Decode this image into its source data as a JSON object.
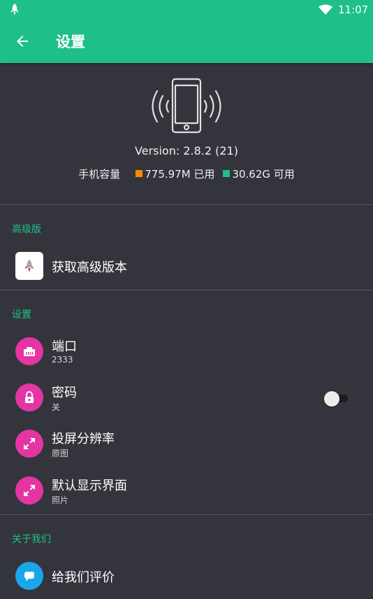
{
  "status_bar": {
    "time": "11:07"
  },
  "app_bar": {
    "title": "设置"
  },
  "device_info": {
    "version": "Version: 2.8.2 (21)",
    "storage_label": "手机容量",
    "used": "775.97M 已用",
    "free": "30.62G 可用",
    "used_color": "#ff8a00",
    "free_color": "#1fbf8a"
  },
  "sections": {
    "premium": {
      "header": "高级版",
      "items": [
        {
          "title": "获取高级版本"
        }
      ]
    },
    "settings": {
      "header": "设置",
      "items": [
        {
          "title": "端口",
          "subtitle": "2333"
        },
        {
          "title": "密码",
          "subtitle": "关",
          "toggle_on": false
        },
        {
          "title": "投屏分辨率",
          "subtitle": "原图"
        },
        {
          "title": "默认显示界面",
          "subtitle": "照片"
        }
      ]
    },
    "about": {
      "header": "关于我们",
      "items": [
        {
          "title": "给我们评价"
        }
      ]
    }
  },
  "colors": {
    "accent": "#1fbf8a",
    "icon_pink": "#e535a4",
    "icon_blue": "#1aa6e8",
    "background": "#34353c"
  },
  "icons": {
    "status_app": "rocket-icon",
    "status_wifi": "wifi-icon",
    "back": "arrow-back-icon",
    "phone": "phone-vibrate-icon",
    "premium": "rocket-app-icon",
    "port": "ethernet-port-icon",
    "password": "lock-icon",
    "resolution": "expand-icon",
    "default_view": "expand-icon",
    "rate": "chat-icon"
  }
}
